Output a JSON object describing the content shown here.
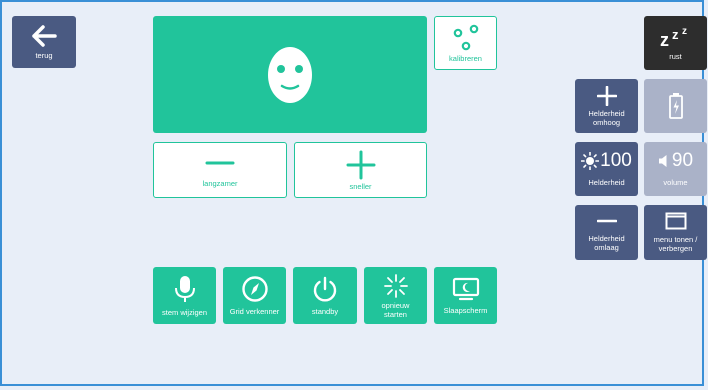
{
  "colors": {
    "accent": "#21c49b",
    "navy": "#4a5a82",
    "slate": "#aab2c8",
    "dark": "#2d2d2d",
    "background": "#e8eef8"
  },
  "back": {
    "label": "terug",
    "icon": "arrow-left-icon"
  },
  "calibrate": {
    "label": "kalibreren",
    "icon": "calibration-dots-icon"
  },
  "speed": {
    "slower_label": "langzamer",
    "slower_icon": "minus-icon",
    "faster_label": "sneller",
    "faster_icon": "plus-icon"
  },
  "bottom_buttons": [
    {
      "label": "stem wijzigen",
      "icon": "microphone-icon"
    },
    {
      "label": "Grid verkenner",
      "icon": "compass-icon"
    },
    {
      "label": "standby",
      "icon": "power-icon"
    },
    {
      "label": "opnieuw starten",
      "icon": "restart-icon"
    },
    {
      "label": "Slaapscherm",
      "icon": "sleep-screen-icon"
    }
  ],
  "side": {
    "rest": {
      "label": "rust",
      "icon": "zzz-icon"
    },
    "brightness_up": {
      "label": "Helderheid omhoog",
      "icon": "plus-icon"
    },
    "battery": {
      "icon": "battery-charging-icon"
    },
    "brightness": {
      "label": "Helderheid",
      "value": "100",
      "icon": "sun-icon"
    },
    "volume": {
      "label": "volume",
      "value": "90",
      "icon": "speaker-icon"
    },
    "brightness_down": {
      "label": "Helderheid omlaag",
      "icon": "minus-icon"
    },
    "menu": {
      "label": "menu tonen / verbergen",
      "icon": "window-icon"
    }
  }
}
